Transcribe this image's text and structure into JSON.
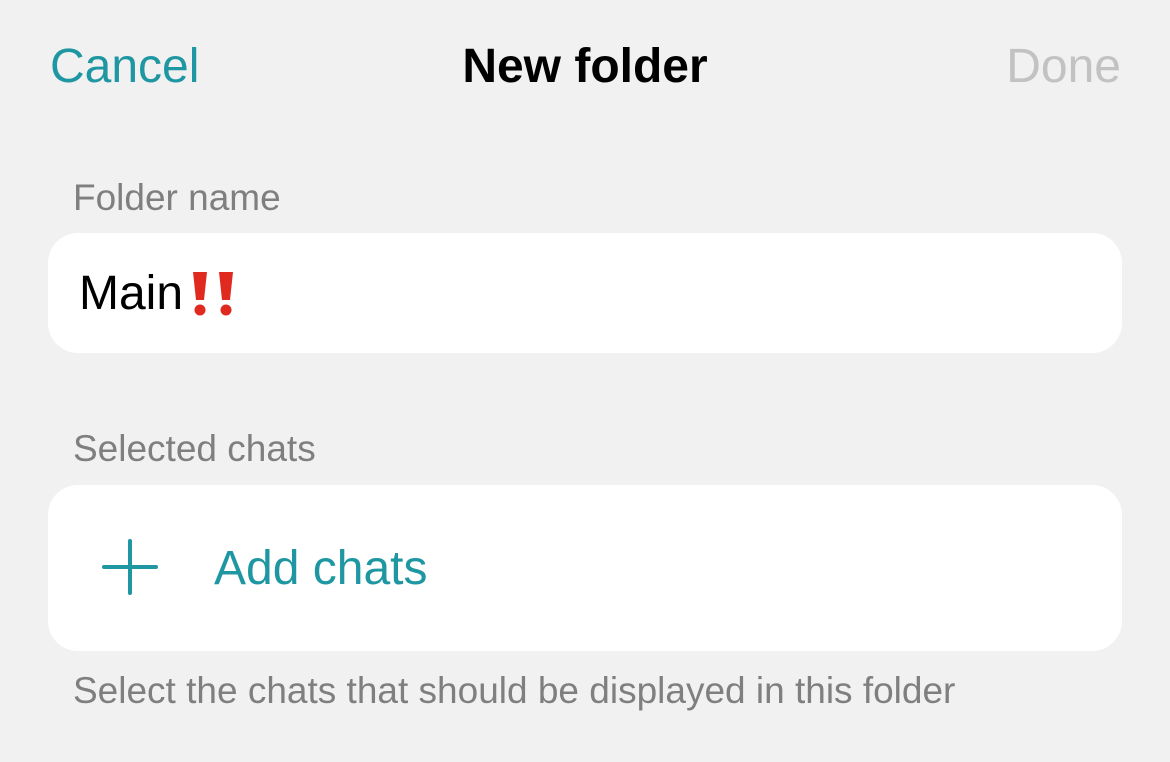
{
  "nav": {
    "cancel_label": "Cancel",
    "title": "New folder",
    "done_label": "Done"
  },
  "folder_name": {
    "section_label": "Folder name",
    "value": "Main",
    "emoji_icon": "double-exclamation-icon"
  },
  "selected_chats": {
    "section_label": "Selected chats",
    "add_label": "Add chats",
    "add_icon": "plus-icon",
    "hint": "Select the chats that should be displayed in this folder"
  },
  "colors": {
    "background": "#f1f1f1",
    "card": "#ffffff",
    "accent": "#1f97a3",
    "disabled": "#c2c2c2",
    "secondary_text": "#7f7f7f",
    "emoji_red": "#e02a1f"
  }
}
